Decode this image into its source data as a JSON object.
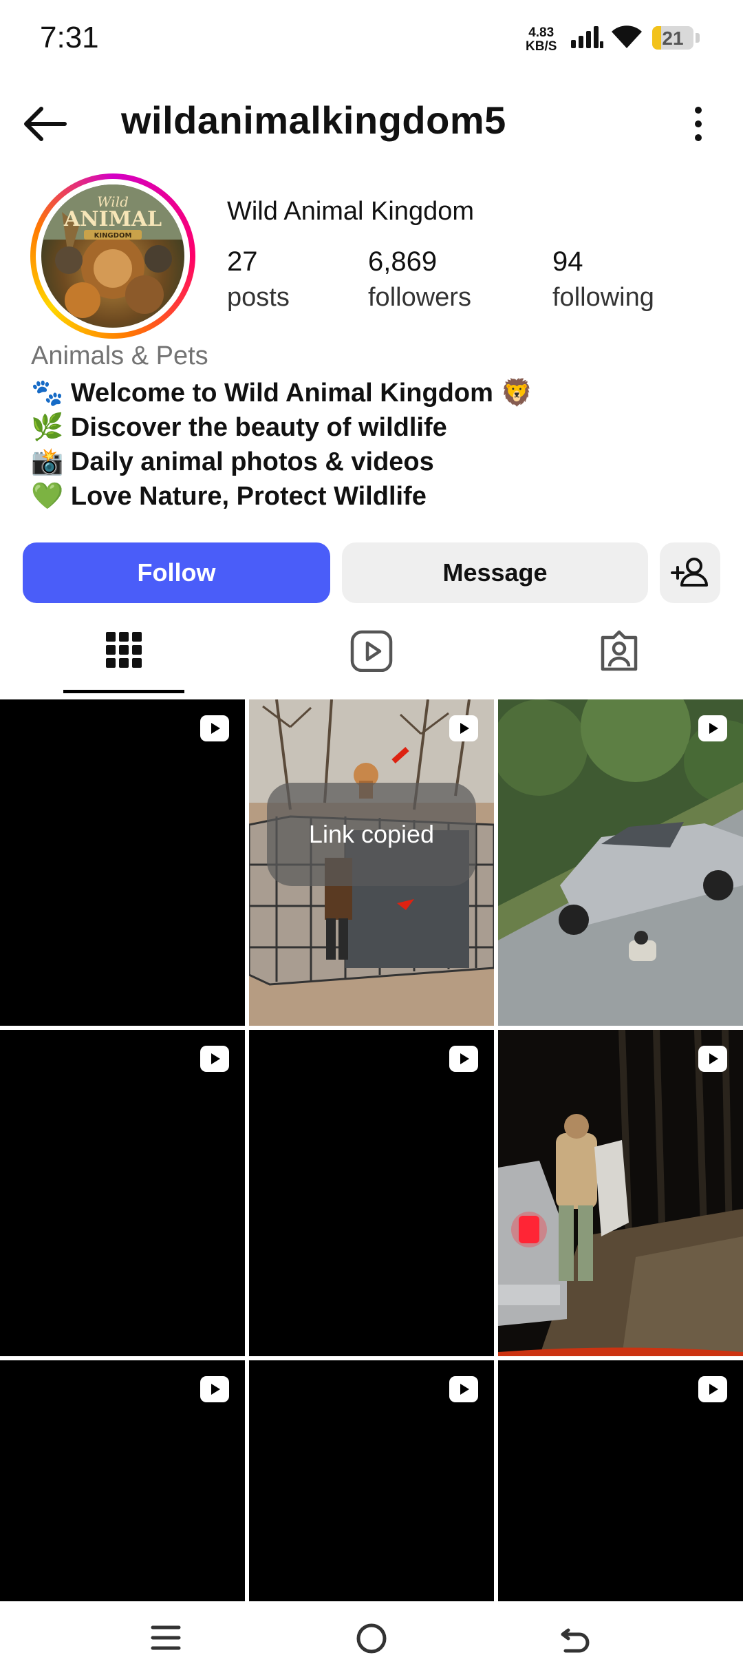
{
  "status_bar": {
    "time": "7:31",
    "net_speed_value": "4.83",
    "net_speed_unit": "KB/S",
    "battery": "21",
    "battery_level": 0.21
  },
  "header": {
    "username": "wildanimalkingdom5"
  },
  "profile": {
    "avatar_text_top": "Wild",
    "avatar_text_main": "ANIMAL",
    "avatar_text_sub": "KINGDOM",
    "name": "Wild Animal Kingdom",
    "stats": [
      {
        "value": "27",
        "label": "posts"
      },
      {
        "value": "6,869",
        "label": "followers"
      },
      {
        "value": "94",
        "label": "following"
      }
    ],
    "category": "Animals & Pets",
    "bio": [
      "🐾 Welcome to Wild Animal Kingdom 🦁",
      "🌿 Discover the beauty of wildlife",
      "📸 Daily animal photos & videos",
      "💚 Love Nature, Protect Wildlife"
    ]
  },
  "actions": {
    "follow": "Follow",
    "message": "Message"
  },
  "tabs": [
    {
      "icon": "grid-icon",
      "selected": true
    },
    {
      "icon": "reels-icon",
      "selected": false
    },
    {
      "icon": "tagged-icon",
      "selected": false
    }
  ],
  "posts": [
    {
      "type": "reel",
      "thumbnail": "black"
    },
    {
      "type": "reel",
      "thumbnail": "cage-lion"
    },
    {
      "type": "reel",
      "thumbnail": "car-road"
    },
    {
      "type": "reel",
      "thumbnail": "black"
    },
    {
      "type": "reel",
      "thumbnail": "black"
    },
    {
      "type": "reel",
      "thumbnail": "night-car"
    },
    {
      "type": "reel",
      "thumbnail": "black"
    },
    {
      "type": "reel",
      "thumbnail": "black"
    },
    {
      "type": "reel",
      "thumbnail": "black"
    }
  ],
  "toast": {
    "text": "Link copied"
  },
  "nav_bar": [
    {
      "icon": "menu-icon"
    },
    {
      "icon": "home-circle-icon"
    },
    {
      "icon": "back-nav-icon"
    }
  ],
  "colors": {
    "follow_button": "#4a5df9",
    "secondary_button": "#efefef",
    "battery": "#f2c21b"
  }
}
